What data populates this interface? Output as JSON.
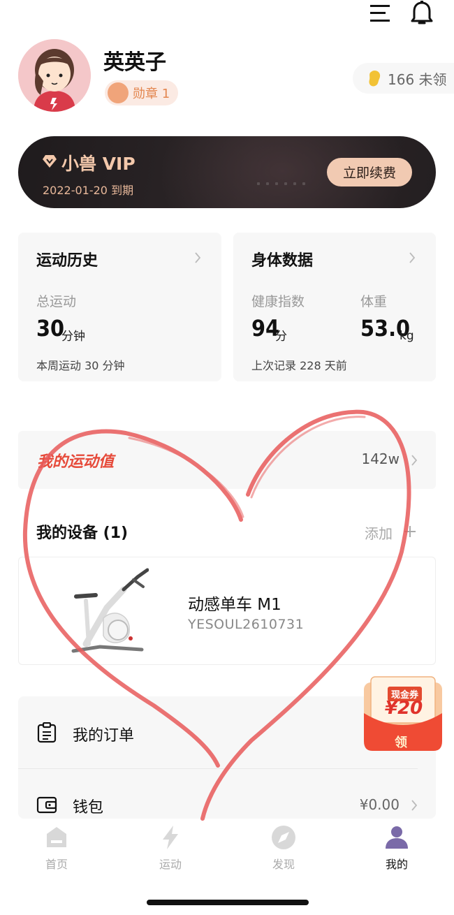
{
  "header": {
    "username": "英英子",
    "badge_label": "勋章 1",
    "coins_text": "166 未领"
  },
  "vip": {
    "title": "小兽 VIP",
    "expiry": "2022-01-20 到期",
    "renew_label": "立即续费"
  },
  "history_card": {
    "title": "运动历史",
    "total_label": "总运动",
    "total_value": "30",
    "total_unit": "分钟",
    "week_text": "本周运动 30 分钟"
  },
  "body_card": {
    "title": "身体数据",
    "health_label": "健康指数",
    "health_value": "94",
    "health_unit": "分",
    "weight_label": "体重",
    "weight_value": "53.0",
    "weight_unit": "kg",
    "last_record": "上次记录 228 天前"
  },
  "motion_value": {
    "label": "我的运动值",
    "value": "142w"
  },
  "devices": {
    "title": "我的设备 (1)",
    "add_label": "添加",
    "items": [
      {
        "name": "动感单车 M1",
        "serial": "YESOUL2610731"
      }
    ]
  },
  "menu": {
    "orders_label": "我的订单",
    "wallet_label": "钱包",
    "wallet_value": "¥0.00"
  },
  "coupon": {
    "title": "现金券",
    "amount": "¥20",
    "claim_label": "领"
  },
  "tabs": [
    {
      "label": "首页",
      "icon": "home-icon"
    },
    {
      "label": "运动",
      "icon": "lightning-icon"
    },
    {
      "label": "发现",
      "icon": "compass-icon"
    },
    {
      "label": "我的",
      "icon": "profile-icon"
    }
  ],
  "colors": {
    "accent_red": "#e64a3a",
    "vip_gold": "#f1cab2",
    "tab_active": "#7a6aa8"
  }
}
